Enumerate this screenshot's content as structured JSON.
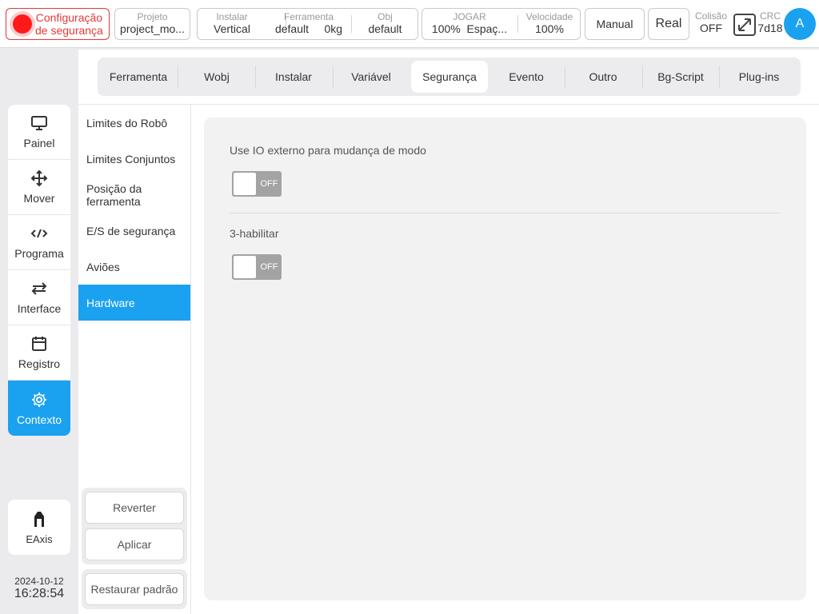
{
  "topbar": {
    "safety": {
      "line1": "Configuração",
      "line2": "de segurança"
    },
    "project": {
      "label": "Projeto",
      "value": "project_mo..."
    },
    "install": {
      "label": "Instalar",
      "value": "Vertical"
    },
    "tool": {
      "label": "Ferramenta",
      "value": "default",
      "weight": "0kg"
    },
    "obj": {
      "label": "Obj",
      "value": "default"
    },
    "jog": {
      "label": "JOGAR",
      "value": "100%",
      "space": "Espaç..."
    },
    "speed": {
      "label": "Velocidade",
      "value": "100%"
    },
    "manual_label": "Manual",
    "real_label": "Real",
    "collision": {
      "label": "Colisão",
      "value": "OFF"
    },
    "crc": {
      "label": "CRC",
      "value": "7d18"
    },
    "avatar": "A"
  },
  "tabs": [
    "Ferramenta",
    "Wobj",
    "Instalar",
    "Variável",
    "Segurança",
    "Evento",
    "Outro",
    "Bg-Script",
    "Plug-ins"
  ],
  "active_tab": "Segurança",
  "leftnav": {
    "items": [
      "Painel",
      "Mover",
      "Programa",
      "Interface",
      "Registro",
      "Contexto"
    ],
    "active": "Contexto",
    "eaxis": "EAxis"
  },
  "datetime": {
    "date": "2024-10-12",
    "time": "16:28:54"
  },
  "submenu": {
    "items": [
      "Limites do Robô",
      "Limites Conjuntos",
      "Posição da ferramenta",
      "E/S de segurança",
      "Aviões",
      "Hardware"
    ],
    "active": "Hardware"
  },
  "actions": {
    "revert": "Reverter",
    "apply": "Aplicar",
    "restore": "Restaurar padrão"
  },
  "settings": {
    "external_io": {
      "label": "Use IO externo para mudança de modo",
      "state": "OFF"
    },
    "three_enable": {
      "label": "3-habilitar",
      "state": "OFF"
    }
  },
  "colors": {
    "accent": "#1aa1f0",
    "danger": "#e53935",
    "toggle_off": "#a3a3a3"
  }
}
